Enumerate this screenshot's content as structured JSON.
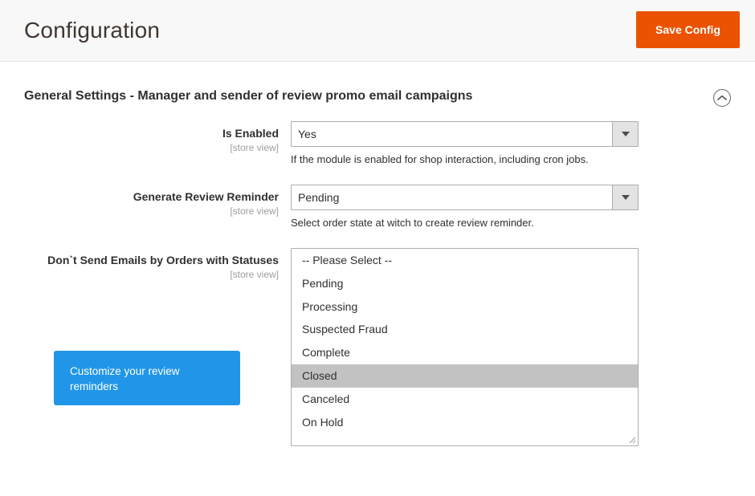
{
  "header": {
    "title": "Configuration",
    "save_label": "Save Config"
  },
  "section": {
    "title": "General Settings - Manager and sender of review promo email campaigns",
    "collapse_icon": "chevron-up-circle-icon"
  },
  "fields": [
    {
      "label": "Is Enabled",
      "scope": "[store view]",
      "type": "select",
      "value": "Yes",
      "note": "If the module is enabled for shop interaction, including cron jobs."
    },
    {
      "label": "Generate Review Reminder",
      "scope": "[store view]",
      "type": "select",
      "value": "Pending",
      "note": "Select order state at witch to create review reminder."
    },
    {
      "label": "Don`t Send Emails by Orders with Statuses",
      "scope": "[store view]",
      "type": "multiselect",
      "options": [
        {
          "label": "-- Please Select --",
          "selected": false
        },
        {
          "label": "Pending",
          "selected": false
        },
        {
          "label": "Processing",
          "selected": false
        },
        {
          "label": "Suspected Fraud",
          "selected": false
        },
        {
          "label": "Complete",
          "selected": false
        },
        {
          "label": "Closed",
          "selected": true
        },
        {
          "label": "Canceled",
          "selected": false
        },
        {
          "label": "On Hold",
          "selected": false
        }
      ]
    }
  ],
  "promo": {
    "text": "Customize your review reminders"
  },
  "colors": {
    "accent_orange": "#eb5202",
    "promo_blue": "#2196e8",
    "selected_gray": "#c2c2c2",
    "header_bg": "#f8f8f8"
  }
}
